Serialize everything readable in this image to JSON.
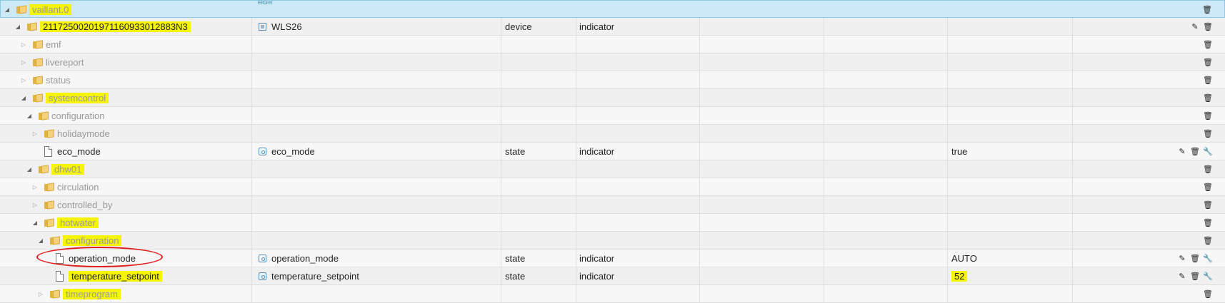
{
  "colors": {
    "highlight": "#f5f500",
    "root_row": "#cde9f7",
    "annotation": "#e01e1e"
  },
  "root": {
    "name": "vaillant.0",
    "tiny_text": "Eltüret"
  },
  "rows": [
    {
      "indent": 0,
      "toggle": "expanded",
      "icon": "folder",
      "name": "21172500201971160933012883N3",
      "highlight": true,
      "muted": false,
      "id_icon": "device",
      "id_name": "WLS26",
      "type": "device",
      "role": "indicator",
      "value": "",
      "actions": [
        "edit",
        "delete"
      ]
    },
    {
      "indent": 1,
      "toggle": "collapsed",
      "icon": "folder",
      "name": "emf",
      "highlight": false,
      "muted": true,
      "actions": [
        "delete"
      ]
    },
    {
      "indent": 1,
      "toggle": "collapsed",
      "icon": "folder",
      "name": "livereport",
      "highlight": false,
      "muted": true,
      "actions": [
        "delete"
      ]
    },
    {
      "indent": 1,
      "toggle": "collapsed",
      "icon": "folder",
      "name": "status",
      "highlight": false,
      "muted": true,
      "actions": [
        "delete"
      ]
    },
    {
      "indent": 1,
      "toggle": "expanded",
      "icon": "folder",
      "name": "systemcontrol",
      "highlight": true,
      "muted": true,
      "actions": [
        "delete"
      ]
    },
    {
      "indent": 2,
      "toggle": "expanded",
      "icon": "folder",
      "name": "configuration",
      "highlight": false,
      "muted": true,
      "actions": [
        "delete"
      ]
    },
    {
      "indent": 3,
      "toggle": "collapsed",
      "icon": "folder",
      "name": "holidaymode",
      "highlight": false,
      "muted": true,
      "actions": [
        "delete"
      ]
    },
    {
      "indent": 3,
      "toggle": "none",
      "icon": "file",
      "name": "eco_mode",
      "highlight": false,
      "muted": false,
      "id_icon": "state",
      "id_name": "eco_mode",
      "type": "state",
      "role": "indicator",
      "value": "true",
      "actions": [
        "edit",
        "delete",
        "settings"
      ]
    },
    {
      "indent": 2,
      "toggle": "expanded",
      "icon": "folder",
      "name": "dhw01",
      "highlight": true,
      "muted": true,
      "actions": [
        "delete"
      ]
    },
    {
      "indent": 3,
      "toggle": "collapsed",
      "icon": "folder",
      "name": "circulation",
      "highlight": false,
      "muted": true,
      "actions": [
        "delete"
      ]
    },
    {
      "indent": 3,
      "toggle": "collapsed",
      "icon": "folder",
      "name": "controlled_by",
      "highlight": false,
      "muted": true,
      "actions": [
        "delete"
      ]
    },
    {
      "indent": 3,
      "toggle": "expanded",
      "icon": "folder",
      "name": "hotwater",
      "highlight": true,
      "muted": true,
      "actions": [
        "delete"
      ]
    },
    {
      "indent": 4,
      "toggle": "expanded",
      "icon": "folder",
      "name": "configuration",
      "highlight": true,
      "muted": true,
      "actions": [
        "delete"
      ]
    },
    {
      "indent": 5,
      "toggle": "none",
      "icon": "file",
      "name": "operation_mode",
      "highlight": false,
      "muted": false,
      "id_icon": "state",
      "id_name": "operation_mode",
      "type": "state",
      "role": "indicator",
      "value": "AUTO",
      "actions": [
        "edit",
        "delete",
        "settings"
      ]
    },
    {
      "indent": 5,
      "toggle": "none",
      "icon": "file",
      "name": "temperature_setpoint",
      "highlight": true,
      "muted": false,
      "circled": true,
      "id_icon": "state",
      "id_name": "temperature_setpoint",
      "type": "state",
      "role": "indicator",
      "value": "52",
      "value_highlight": true,
      "actions": [
        "edit",
        "delete",
        "settings"
      ]
    },
    {
      "indent": 4,
      "toggle": "collapsed",
      "icon": "folder",
      "name": "timeprogram",
      "highlight": true,
      "muted": true,
      "actions": [
        "delete"
      ]
    }
  ],
  "icons": {
    "edit": "pencil-icon",
    "delete": "trash-icon",
    "settings": "wrench-icon"
  }
}
